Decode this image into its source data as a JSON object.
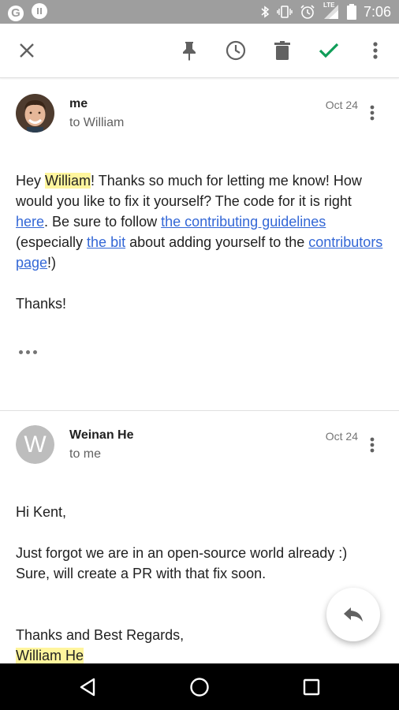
{
  "status_bar": {
    "time": "7:06",
    "left_icons": [
      "google-g-icon",
      "notification-icon"
    ],
    "g_letter": "G",
    "right_icons": [
      "bluetooth-icon",
      "vibrate-icon",
      "alarm-icon",
      "lte-signal-icon",
      "battery-icon"
    ],
    "lte_label": "LTE"
  },
  "toolbar": {
    "actions": [
      "close",
      "pin",
      "snooze",
      "delete",
      "mark-done",
      "more"
    ],
    "done_color": "#0f9d58"
  },
  "messages": [
    {
      "sender": "me",
      "recipient": "to William",
      "date": "Oct 24",
      "avatar": "photo",
      "body": {
        "l1_a": "Hey ",
        "l1_hl": "William",
        "l1_b": "! Thanks so much for letting me know! How would you like to fix it yourself? The code for it is right ",
        "link_here": "here",
        "l2_a": ". Be sure to follow ",
        "link_guidelines": "the contributing guidelines",
        "l3_a": " (especially ",
        "link_bit": "the bit",
        "l3_b": " about adding yourself to the ",
        "link_contributors": "contributors page",
        "l3_c": "!)",
        "closing": "Thanks!"
      }
    },
    {
      "sender": "Weinan He",
      "recipient": "to me",
      "date": "Oct 24",
      "avatar_letter": "W",
      "body": {
        "greeting": "Hi Kent,",
        "line1": "Just forgot we are in an open-source world already :)",
        "line2": "Sure, will create a PR with that fix soon.",
        "signoff": "Thanks and Best Regards,",
        "signature": "William He"
      }
    }
  ],
  "fab": {
    "icon": "reply-icon"
  },
  "nav_bar": {
    "buttons": [
      "back",
      "home",
      "recents"
    ]
  },
  "colors": {
    "highlight": "#fff59d",
    "link": "#3367d6",
    "accent_check": "#0f9d58"
  }
}
